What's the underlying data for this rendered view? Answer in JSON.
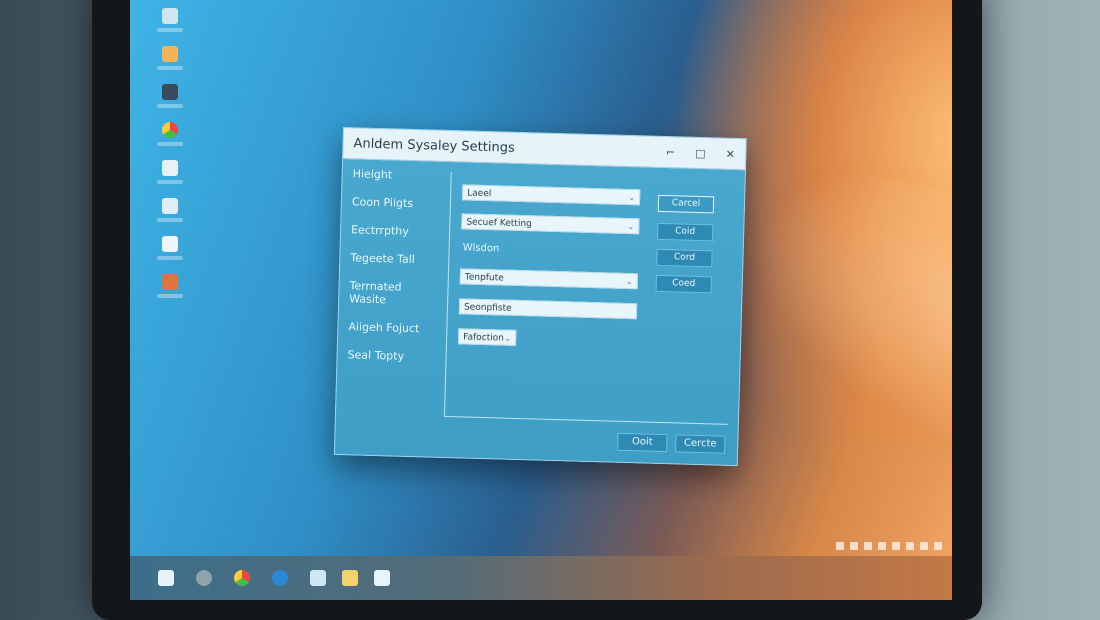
{
  "window": {
    "title": "Anldem Sysaley Settings",
    "controls": [
      "⌐",
      "□",
      "✕"
    ]
  },
  "sidebar": {
    "items": [
      "Hielght",
      "Coon Piigts",
      "Eectrrpthy",
      "Tegeete Tall",
      "Terrnated Wasite",
      "Aiigeh Fojuct",
      "Seal Topty"
    ]
  },
  "form": {
    "dropdown1": "Laeel",
    "dropdown2": "Secuef Ketting",
    "label_window": "Wlsdon",
    "dropdown3": "Tenpfute",
    "text_input": "Seonpfiste",
    "small_select": "Fafoction"
  },
  "right_buttons": [
    "Carcel",
    "Coid",
    "Cord",
    "Coed"
  ],
  "footer": {
    "ok": "Ooit",
    "cancel": "Cercte"
  },
  "colors": {
    "dialog_bg": "#3f9ec6",
    "titlebar_bg": "#e6f3f8",
    "button_bg": "#2e89b5"
  },
  "desktop_icons": [
    "recycle-bin-icon",
    "folder-icon",
    "photo-icon",
    "chrome-icon",
    "document-icon",
    "music-icon",
    "file-icon",
    "media-icon"
  ],
  "taskbar_icons": [
    "start-icon",
    "search-icon",
    "chrome-icon",
    "edge-icon",
    "explorer-icon",
    "notes-icon",
    "app-icon"
  ]
}
